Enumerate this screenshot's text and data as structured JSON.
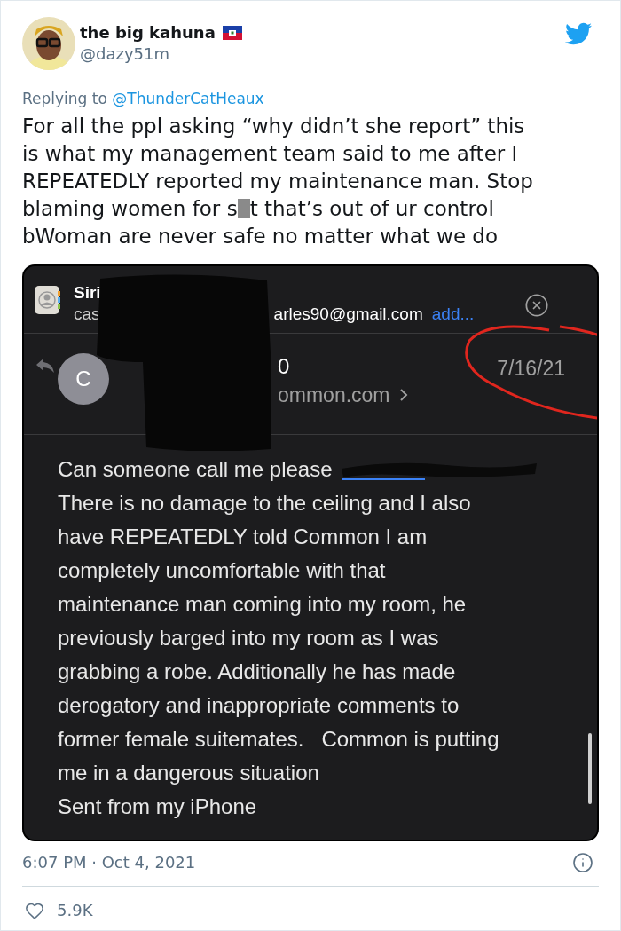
{
  "author": {
    "name": "the big kahuna",
    "handle": "@dazy51m"
  },
  "reply_to": {
    "prefix": "Replying to",
    "handle": "@ThunderCatHeaux"
  },
  "text": {
    "before_censor": "For all the ppl asking “why didn’t she report” this\nis what my management team said to me after I\nREPEATEDLY reported my maintenance man. Stop\nblaming women for s",
    "after_censor": "t that’s out of ur control\nbWoman are never safe no matter what we do"
  },
  "screenshot": {
    "banner": {
      "title": "Siri",
      "line_start": "cas",
      "line_end": "arles90@gmail.com",
      "action": "add..."
    },
    "sender": {
      "initial": "C",
      "name_fragment": "0",
      "address_fragment": "ommon.com",
      "date": "7/16/21"
    },
    "body_first_line": "Can someone call me please",
    "body_rest": "There is no damage to the ceiling and I also\nhave REPEATEDLY told Common I am\ncompletely uncomfortable with that\nmaintenance man coming into my room, he\npreviously barged into my room as I was\ngrabbing a robe. Additionally he has made\nderogatory and inappropriate comments to\nformer female suitemates.   Common is putting\nme in a dangerous situation\nSent from my iPhone"
  },
  "timestamp": "6:07 PM · Oct 4, 2021",
  "likes": "5.9K"
}
